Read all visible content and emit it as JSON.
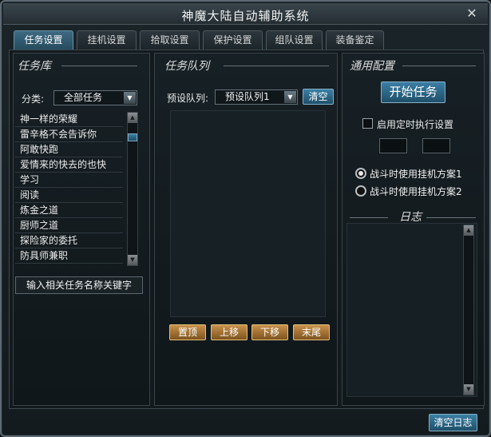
{
  "window": {
    "title": "神魔大陆自动辅助系统",
    "close_glyph": "✕"
  },
  "tabs": [
    {
      "label": "任务设置",
      "active": true
    },
    {
      "label": "挂机设置",
      "active": false
    },
    {
      "label": "拾取设置",
      "active": false
    },
    {
      "label": "保护设置",
      "active": false
    },
    {
      "label": "组队设置",
      "active": false
    },
    {
      "label": "装备鉴定",
      "active": false
    }
  ],
  "task_library": {
    "title": "任务库",
    "category_label": "分类:",
    "category_value": "全部任务",
    "items": [
      "神一样的荣耀",
      "雷辛格不会告诉你",
      "阿敢快跑",
      "爱情来的快去的也快",
      "学习",
      "阅读",
      "炼金之道",
      "厨师之道",
      "探险家的委托",
      "防具师兼职"
    ],
    "search_placeholder": "输入相关任务名称关键字"
  },
  "task_queue": {
    "title": "任务队列",
    "preset_label": "预设队列:",
    "preset_value": "预设队列1",
    "clear_label": "清空",
    "buttons": {
      "top": "置顶",
      "up": "上移",
      "down": "下移",
      "bottom": "末尾"
    }
  },
  "general_config": {
    "title": "通用配置",
    "start_label": "开始任务",
    "timer_label": "启用定时执行设置",
    "timer_checked": false,
    "radio1_label": "战斗时使用挂机方案1",
    "radio2_label": "战斗时使用挂机方案2",
    "selected_plan": 1,
    "log_title": "日志"
  },
  "footer": {
    "clear_log_label": "清空日志"
  },
  "icons": {
    "close": "close-icon",
    "dropdown": "chevron-down-icon",
    "scroll_up": "triangle-up-icon",
    "scroll_down": "triangle-down-icon"
  },
  "colors": {
    "active_tab": "#3e6a82",
    "gold_button": "#c8924a",
    "blue_button": "#3b7fa4"
  }
}
